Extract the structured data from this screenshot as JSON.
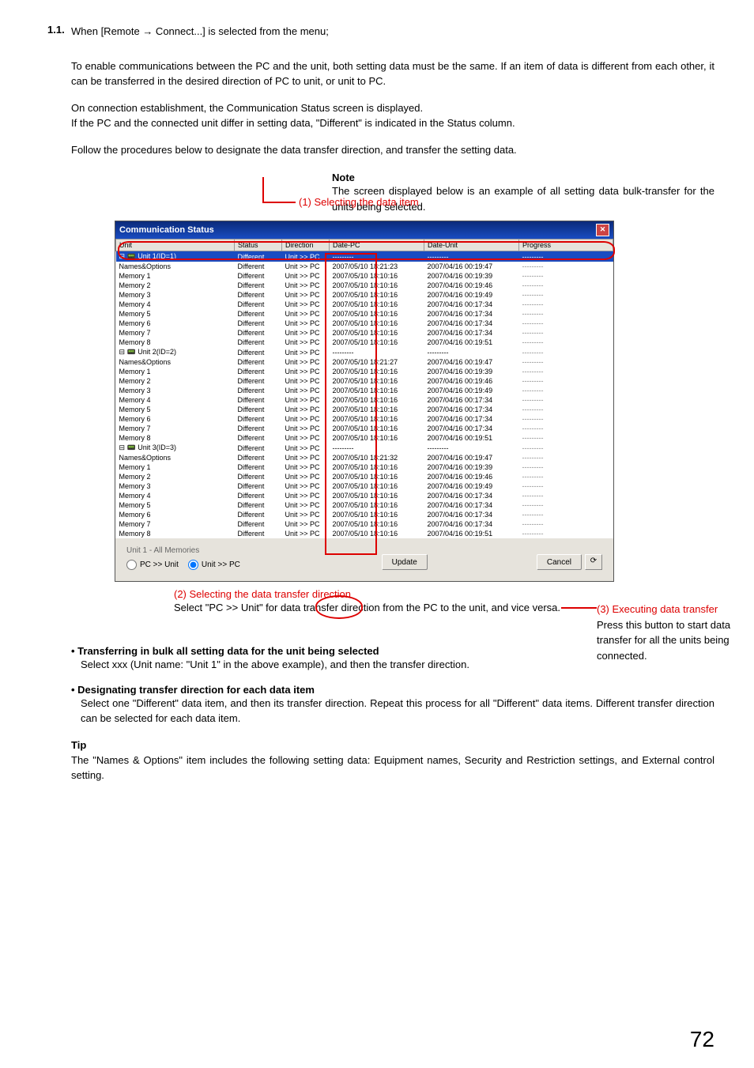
{
  "section": {
    "number": "1.1.",
    "lead": "When [Remote → Connect...] is selected from the menu;",
    "paragraphs": [
      "To enable communications between the PC and the unit, both setting data must be the same. If an item of data is different from each other, it can be transferred in the desired direction of PC to unit, or unit to PC.",
      "On connection establishment, the Communication Status screen is displayed.",
      "If the PC and the connected unit differ in setting data, \"Different\" is indicated in the Status column.",
      "Follow the procedures below to designate the data transfer direction, and transfer the setting data."
    ]
  },
  "callouts": {
    "c1_title": "(1) Selecting the data item",
    "note_head": "Note",
    "note_body": "The screen displayed below is an example of all setting data bulk-transfer for the units being selected.",
    "c2_title": "(2) Selecting the data transfer direction",
    "c2_desc": "Select \"PC >> Unit\" for data transfer direction from the PC to the unit, and vice versa.",
    "c3_title": "(3) Executing data transfer",
    "c3_desc": "Press this button to start data transfer for all the units being connected."
  },
  "window": {
    "title": "Communication Status",
    "columns": [
      "Unit",
      "Status",
      "Direction",
      "Date-PC",
      "Date-Unit",
      "Progress"
    ],
    "selected_row": {
      "unit": "⊟ 📟 Unit 1(ID=1)",
      "status": "Different",
      "direction": "Unit >> PC",
      "date_pc": "---------",
      "date_unit": "---------",
      "progress": "---------"
    },
    "rows": [
      {
        "unit": "      Names&Options",
        "status": "Different",
        "direction": "Unit >> PC",
        "date_pc": "2007/05/10 18:21:23",
        "date_unit": "2007/04/16 00:19:47",
        "progress": "---------"
      },
      {
        "unit": "      Memory 1",
        "status": "Different",
        "direction": "Unit >> PC",
        "date_pc": "2007/05/10 18:10:16",
        "date_unit": "2007/04/16 00:19:39",
        "progress": "---------"
      },
      {
        "unit": "      Memory 2",
        "status": "Different",
        "direction": "Unit >> PC",
        "date_pc": "2007/05/10 18:10:16",
        "date_unit": "2007/04/16 00:19:46",
        "progress": "---------"
      },
      {
        "unit": "      Memory 3",
        "status": "Different",
        "direction": "Unit >> PC",
        "date_pc": "2007/05/10 18:10:16",
        "date_unit": "2007/04/16 00:19:49",
        "progress": "---------"
      },
      {
        "unit": "      Memory 4",
        "status": "Different",
        "direction": "Unit >> PC",
        "date_pc": "2007/05/10 18:10:16",
        "date_unit": "2007/04/16 00:17:34",
        "progress": "---------"
      },
      {
        "unit": "      Memory 5",
        "status": "Different",
        "direction": "Unit >> PC",
        "date_pc": "2007/05/10 18:10:16",
        "date_unit": "2007/04/16 00:17:34",
        "progress": "---------"
      },
      {
        "unit": "      Memory 6",
        "status": "Different",
        "direction": "Unit >> PC",
        "date_pc": "2007/05/10 18:10:16",
        "date_unit": "2007/04/16 00:17:34",
        "progress": "---------"
      },
      {
        "unit": "      Memory 7",
        "status": "Different",
        "direction": "Unit >> PC",
        "date_pc": "2007/05/10 18:10:16",
        "date_unit": "2007/04/16 00:17:34",
        "progress": "---------"
      },
      {
        "unit": "      Memory 8",
        "status": "Different",
        "direction": "Unit >> PC",
        "date_pc": "2007/05/10 18:10:16",
        "date_unit": "2007/04/16 00:19:51",
        "progress": "---------"
      },
      {
        "unit": "⊟ 📟 Unit 2(ID=2)",
        "status": "Different",
        "direction": "Unit >> PC",
        "date_pc": "---------",
        "date_unit": "---------",
        "progress": "---------"
      },
      {
        "unit": "      Names&Options",
        "status": "Different",
        "direction": "Unit >> PC",
        "date_pc": "2007/05/10 18:21:27",
        "date_unit": "2007/04/16 00:19:47",
        "progress": "---------"
      },
      {
        "unit": "      Memory 1",
        "status": "Different",
        "direction": "Unit >> PC",
        "date_pc": "2007/05/10 18:10:16",
        "date_unit": "2007/04/16 00:19:39",
        "progress": "---------"
      },
      {
        "unit": "      Memory 2",
        "status": "Different",
        "direction": "Unit >> PC",
        "date_pc": "2007/05/10 18:10:16",
        "date_unit": "2007/04/16 00:19:46",
        "progress": "---------"
      },
      {
        "unit": "      Memory 3",
        "status": "Different",
        "direction": "Unit >> PC",
        "date_pc": "2007/05/10 18:10:16",
        "date_unit": "2007/04/16 00:19:49",
        "progress": "---------"
      },
      {
        "unit": "      Memory 4",
        "status": "Different",
        "direction": "Unit >> PC",
        "date_pc": "2007/05/10 18:10:16",
        "date_unit": "2007/04/16 00:17:34",
        "progress": "---------"
      },
      {
        "unit": "      Memory 5",
        "status": "Different",
        "direction": "Unit >> PC",
        "date_pc": "2007/05/10 18:10:16",
        "date_unit": "2007/04/16 00:17:34",
        "progress": "---------"
      },
      {
        "unit": "      Memory 6",
        "status": "Different",
        "direction": "Unit >> PC",
        "date_pc": "2007/05/10 18:10:16",
        "date_unit": "2007/04/16 00:17:34",
        "progress": "---------"
      },
      {
        "unit": "      Memory 7",
        "status": "Different",
        "direction": "Unit >> PC",
        "date_pc": "2007/05/10 18:10:16",
        "date_unit": "2007/04/16 00:17:34",
        "progress": "---------"
      },
      {
        "unit": "      Memory 8",
        "status": "Different",
        "direction": "Unit >> PC",
        "date_pc": "2007/05/10 18:10:16",
        "date_unit": "2007/04/16 00:19:51",
        "progress": "---------"
      },
      {
        "unit": "⊟ 📟 Unit 3(ID=3)",
        "status": "Different",
        "direction": "Unit >> PC",
        "date_pc": "---------",
        "date_unit": "---------",
        "progress": "---------"
      },
      {
        "unit": "      Names&Options",
        "status": "Different",
        "direction": "Unit >> PC",
        "date_pc": "2007/05/10 18:21:32",
        "date_unit": "2007/04/16 00:19:47",
        "progress": "---------"
      },
      {
        "unit": "      Memory 1",
        "status": "Different",
        "direction": "Unit >> PC",
        "date_pc": "2007/05/10 18:10:16",
        "date_unit": "2007/04/16 00:19:39",
        "progress": "---------"
      },
      {
        "unit": "      Memory 2",
        "status": "Different",
        "direction": "Unit >> PC",
        "date_pc": "2007/05/10 18:10:16",
        "date_unit": "2007/04/16 00:19:46",
        "progress": "---------"
      },
      {
        "unit": "      Memory 3",
        "status": "Different",
        "direction": "Unit >> PC",
        "date_pc": "2007/05/10 18:10:16",
        "date_unit": "2007/04/16 00:19:49",
        "progress": "---------"
      },
      {
        "unit": "      Memory 4",
        "status": "Different",
        "direction": "Unit >> PC",
        "date_pc": "2007/05/10 18:10:16",
        "date_unit": "2007/04/16 00:17:34",
        "progress": "---------"
      },
      {
        "unit": "      Memory 5",
        "status": "Different",
        "direction": "Unit >> PC",
        "date_pc": "2007/05/10 18:10:16",
        "date_unit": "2007/04/16 00:17:34",
        "progress": "---------"
      },
      {
        "unit": "      Memory 6",
        "status": "Different",
        "direction": "Unit >> PC",
        "date_pc": "2007/05/10 18:10:16",
        "date_unit": "2007/04/16 00:17:34",
        "progress": "---------"
      },
      {
        "unit": "      Memory 7",
        "status": "Different",
        "direction": "Unit >> PC",
        "date_pc": "2007/05/10 18:10:16",
        "date_unit": "2007/04/16 00:17:34",
        "progress": "---------"
      },
      {
        "unit": "      Memory 8",
        "status": "Different",
        "direction": "Unit >> PC",
        "date_pc": "2007/05/10 18:10:16",
        "date_unit": "2007/04/16 00:19:51",
        "progress": "---------"
      }
    ],
    "footer_label": "Unit 1 - All Memories",
    "radio_pc_unit": "PC >> Unit",
    "radio_unit_pc": "Unit >> PC",
    "update_btn": "Update",
    "cancel_btn": "Cancel",
    "refresh_icon": "⟳"
  },
  "bullets": [
    {
      "head": "Transferring in bulk all setting data for the unit being selected",
      "body": "Select xxx (Unit name: \"Unit 1\" in the above example), and then the transfer direction."
    },
    {
      "head": "Designating transfer direction for each data item",
      "body": "Select one \"Different\" data item, and then its transfer direction. Repeat this process for all \"Different\" data items. Different transfer direction can be selected for each data item."
    }
  ],
  "tip": {
    "head": "Tip",
    "body": "The \"Names & Options\" item includes the following setting data: Equipment names, Security and Restriction settings, and External control setting."
  },
  "page_number": "72"
}
